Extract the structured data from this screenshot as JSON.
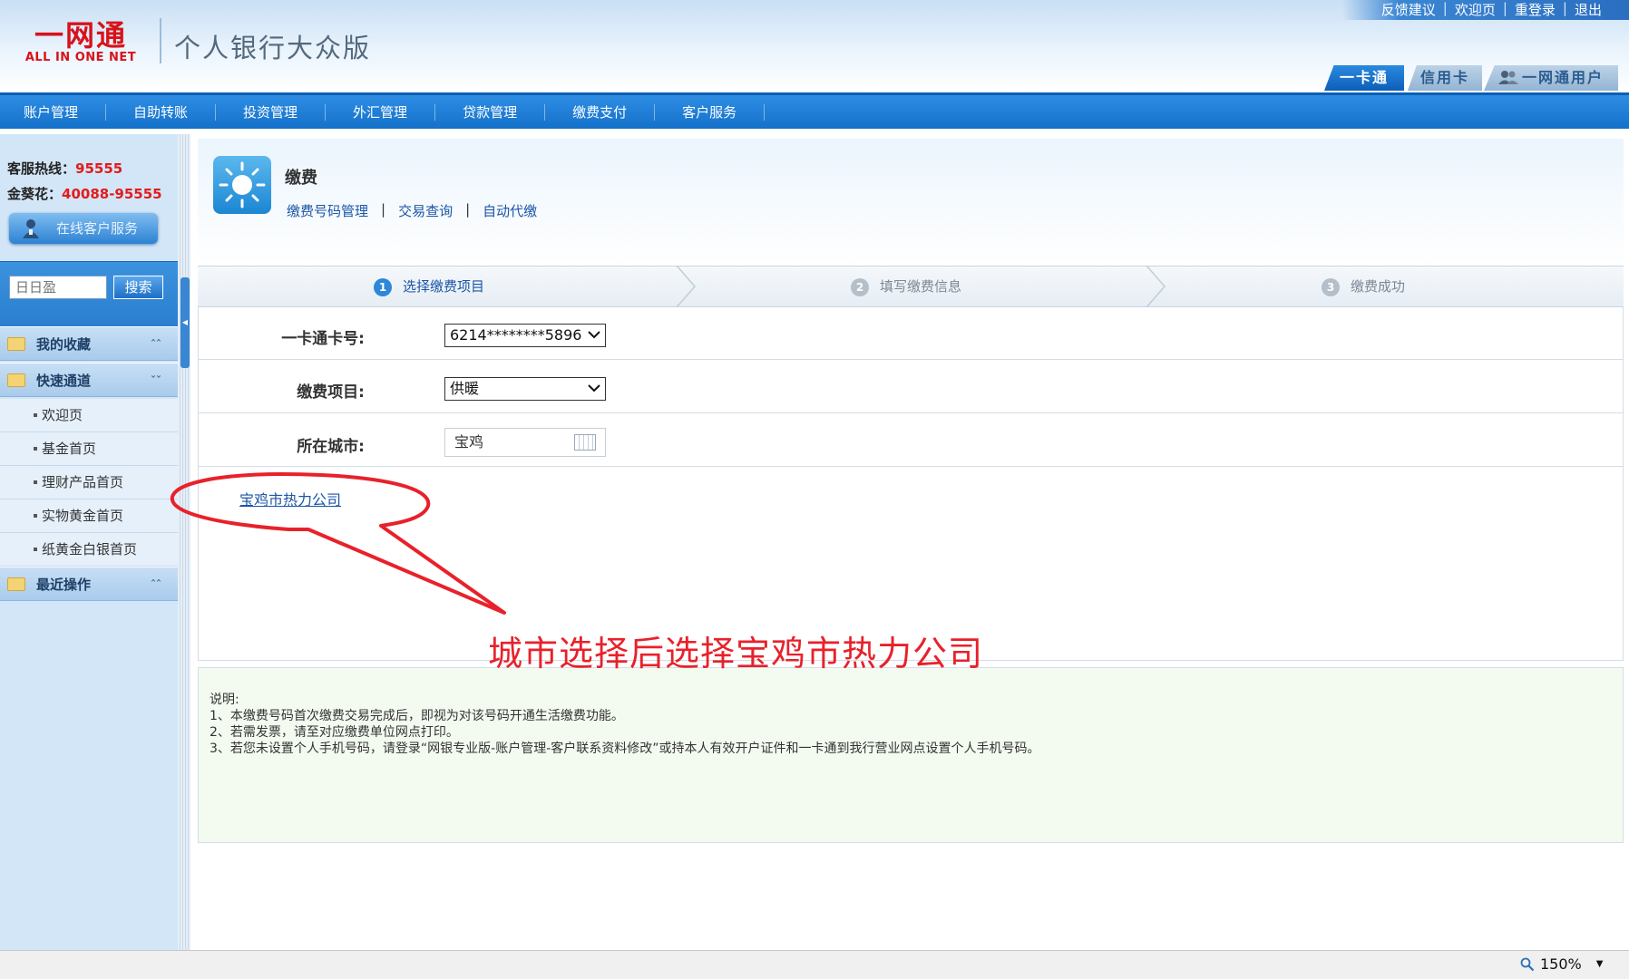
{
  "header": {
    "logo_cn": "一网通",
    "logo_en": "ALL IN ONE NET",
    "app_title": "个人银行大众版",
    "top_links": [
      "反馈建议",
      "欢迎页",
      "重登录",
      "退出"
    ],
    "card_tabs": [
      "一卡通",
      "信用卡",
      "一网通用户"
    ],
    "active_card_tab": "一卡通"
  },
  "nav": {
    "items": [
      "账户管理",
      "自助转账",
      "投资管理",
      "外汇管理",
      "贷款管理",
      "缴费支付",
      "客户服务"
    ]
  },
  "sidebar": {
    "hotline_label": "客服热线：",
    "hotline_number": "95555",
    "sunflower_label": "金葵花：",
    "sunflower_number": "40088-95555",
    "online_service": "在线客户服务",
    "search_placeholder": "日日盈",
    "search_button": "搜索",
    "favorites": "我的收藏",
    "quick_access": "快速通道",
    "quick_items": [
      "欢迎页",
      "基金首页",
      "理财产品首页",
      "实物黄金首页",
      "纸黄金白银首页"
    ],
    "recent": "最近操作"
  },
  "main": {
    "section_title": "缴费",
    "sublinks": [
      "缴费号码管理",
      "交易查询",
      "自动代缴"
    ],
    "steps": [
      {
        "num": "1",
        "label": "选择缴费项目"
      },
      {
        "num": "2",
        "label": "填写缴费信息"
      },
      {
        "num": "3",
        "label": "缴费成功"
      }
    ],
    "form": {
      "card_label": "一卡通卡号:",
      "card_value": "6214********5896",
      "item_label": "缴费项目:",
      "item_value": "供暖",
      "city_label": "所在城市:",
      "city_value": "宝鸡"
    },
    "company_link": "宝鸡市热力公司",
    "notes": {
      "title": "说明:",
      "lines": [
        "1、本缴费号码首次缴费交易完成后，即视为对该号码开通生活缴费功能。",
        "2、若需发票，请至对应缴费单位网点打印。",
        "3、若您未设置个人手机号码，请登录“网银专业版-账户管理-客户联系资料修改”或持本人有效开户证件和一卡通到我行营业网点设置个人手机号码。"
      ]
    }
  },
  "annotation": {
    "text": "城市选择后选择宝鸡市热力公司",
    "color": "#e8212a"
  },
  "statusbar": {
    "zoom": "150%"
  },
  "colors": {
    "accent": "#1471cb",
    "link": "#1a55a6",
    "hotline": "#e31b1b"
  }
}
